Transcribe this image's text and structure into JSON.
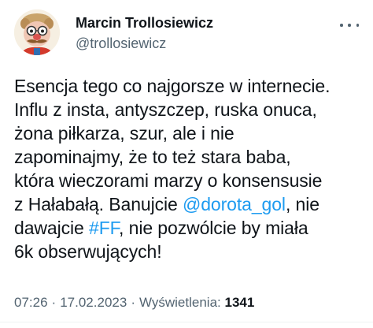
{
  "author": {
    "display_name": "Marcin Trollosiewicz",
    "handle": "@trollosiewicz"
  },
  "tweet": {
    "lines": [
      [
        {
          "text": "Esencja tego co najgorsze w internecie."
        }
      ],
      [
        {
          "text": "Influ z insta, antyszczep, ruska onuca,"
        }
      ],
      [
        {
          "text": "żona piłkarza, szur, ale i nie"
        }
      ],
      [
        {
          "text": "zapominajmy, że to też stara baba,"
        }
      ],
      [
        {
          "text": "która wieczorami marzy o konsensusie"
        }
      ],
      [
        {
          "text": "z Hałabałą. Banujcie "
        },
        {
          "text": "@dorota_gol",
          "link": true
        },
        {
          "text": ", nie"
        }
      ],
      [
        {
          "text": "dawajcie "
        },
        {
          "text": "#FF",
          "link": true
        },
        {
          "text": ", nie pozwólcie by miała"
        }
      ],
      [
        {
          "text": "6k obserwujących!"
        }
      ]
    ]
  },
  "meta": {
    "time": "07:26",
    "separator": "·",
    "date": "17.02.2023",
    "views_label": "Wyświetlenia:",
    "views_count": "1341"
  },
  "colors": {
    "link": "#1d9bf0",
    "secondary_text": "#536471",
    "primary_text": "#0f1419"
  },
  "icons": {
    "avatar": "cartoon-character-avatar",
    "more": "more-horizontal-icon"
  }
}
